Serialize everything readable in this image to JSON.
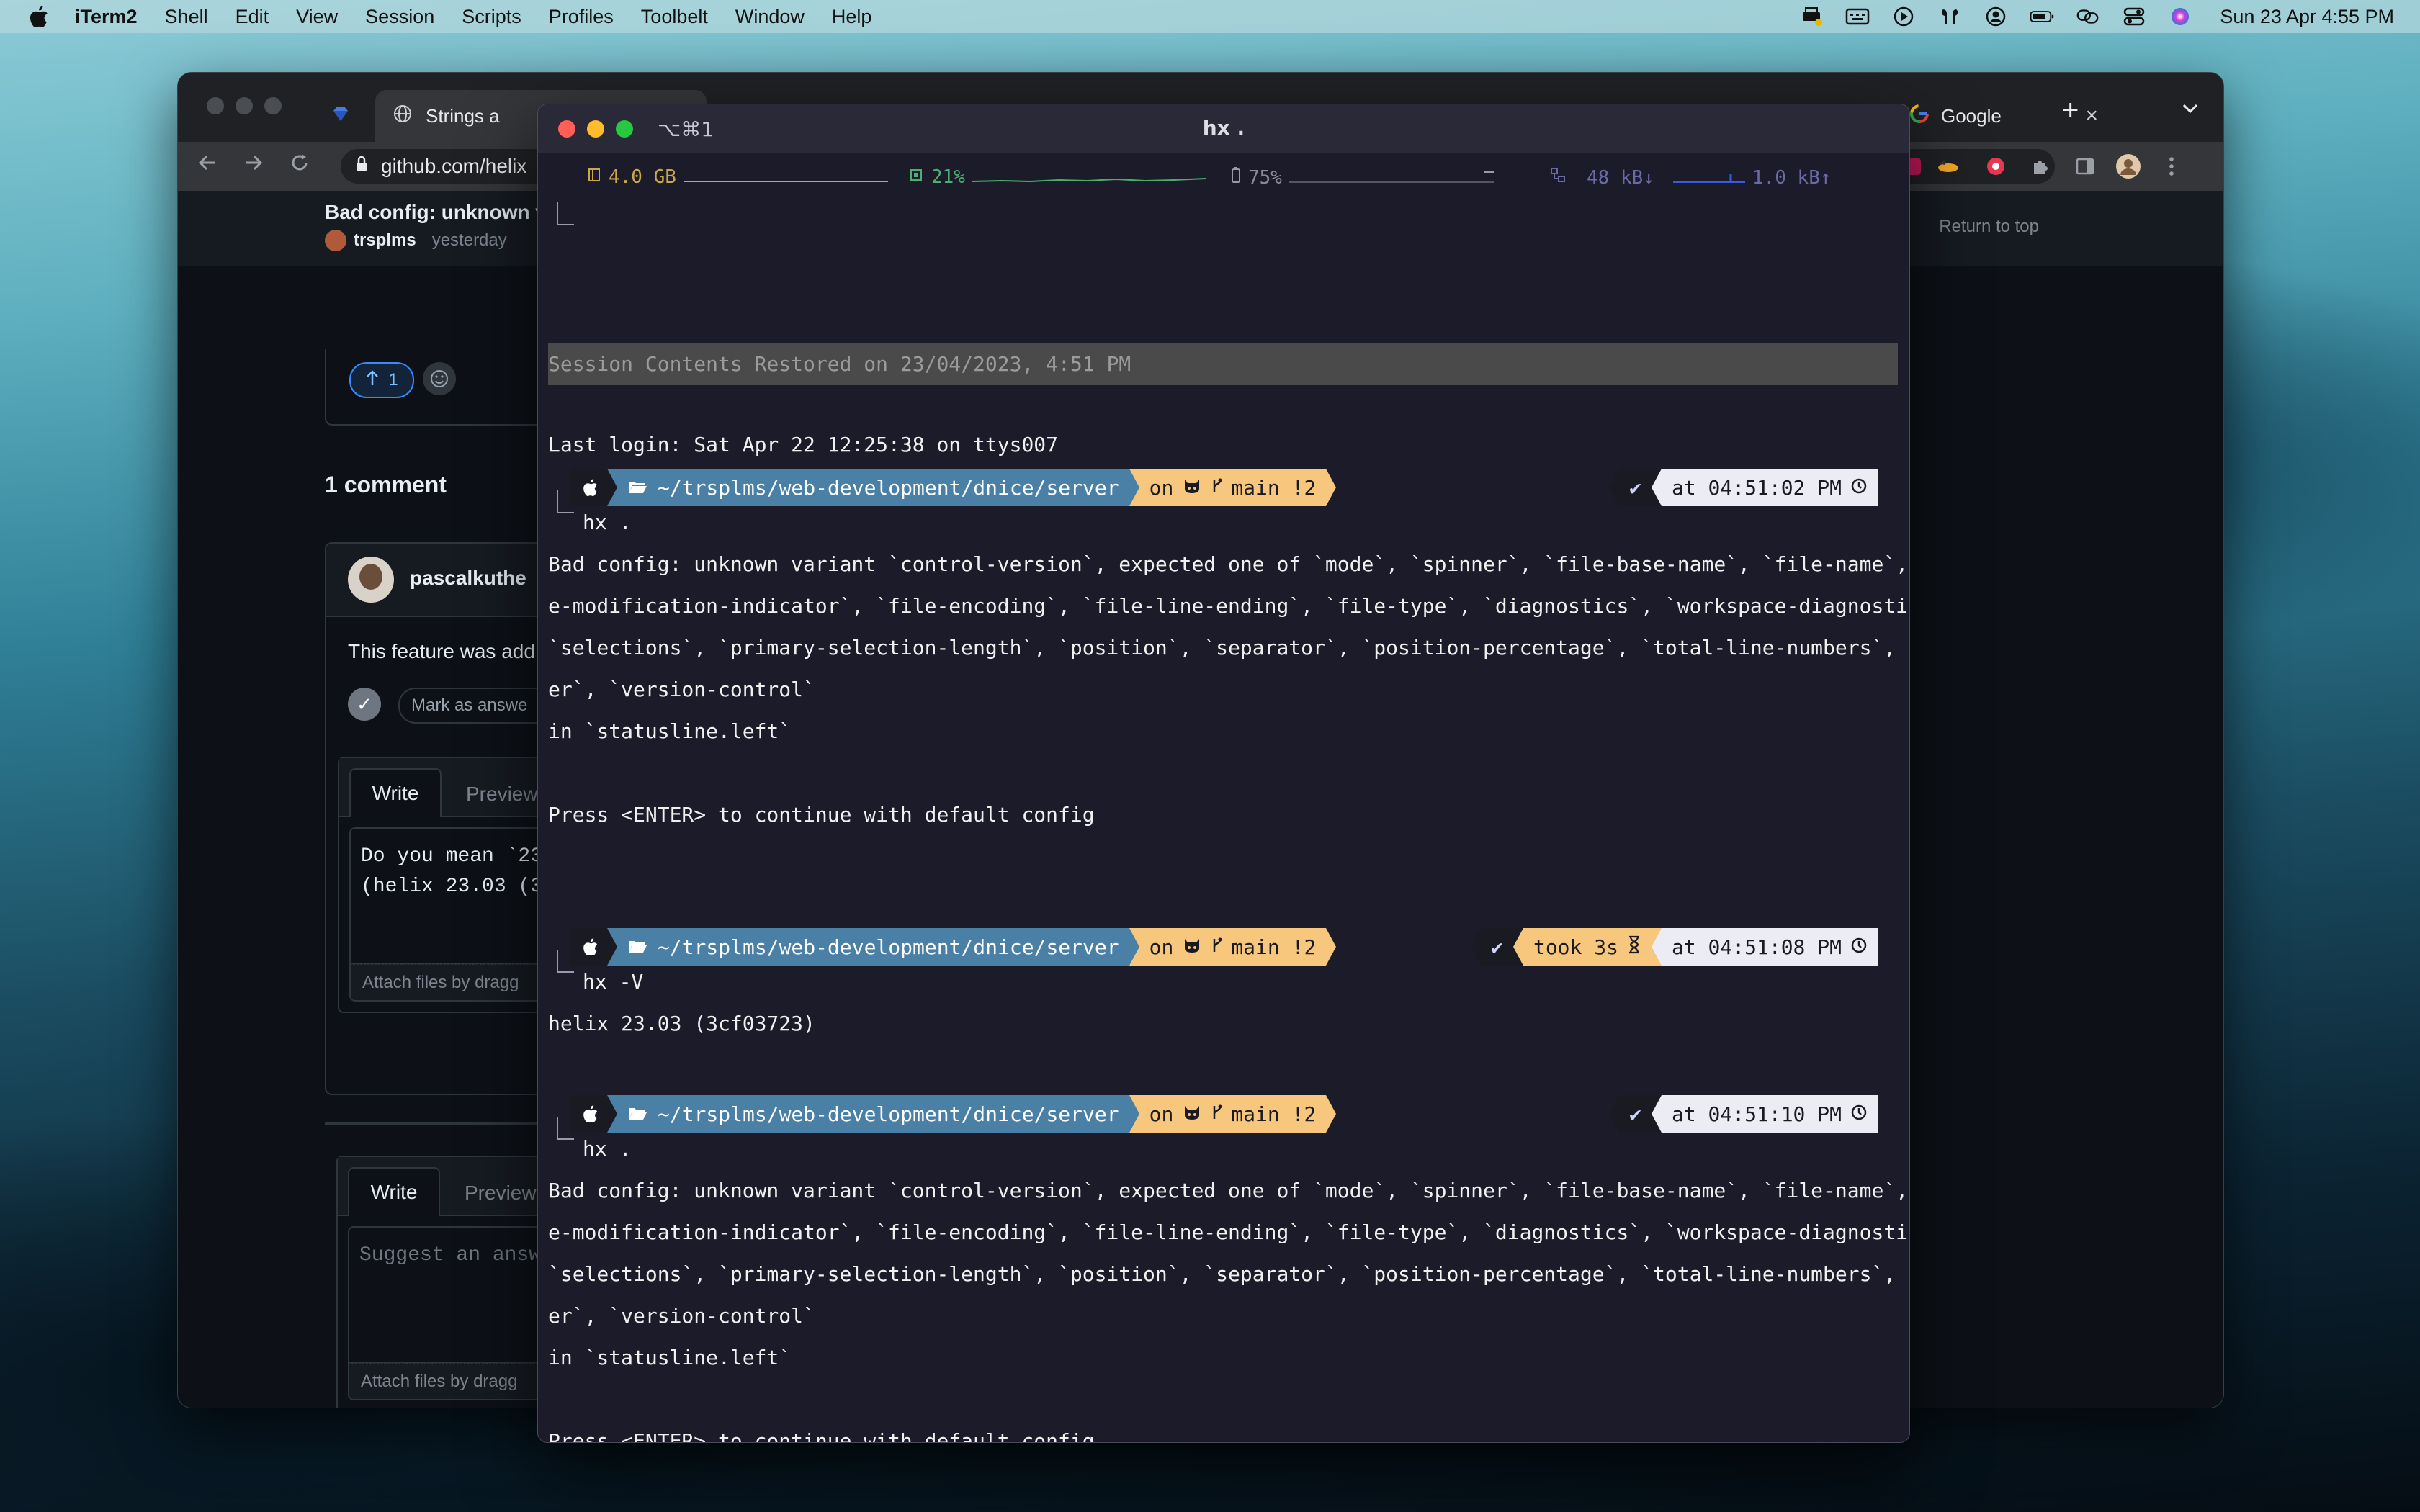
{
  "menubar": {
    "app": "iTerm2",
    "items": [
      "Shell",
      "Edit",
      "View",
      "Session",
      "Scripts",
      "Profiles",
      "Toolbelt",
      "Window",
      "Help"
    ],
    "clock": "Sun 23 Apr  4:55 PM"
  },
  "browser": {
    "tab_strings": "Strings a",
    "tab_google": "Google",
    "url": "github.com/helix",
    "issue_title": "Bad config: unknown v",
    "author": "trsplms",
    "posted": "yesterday",
    "return_to_top": "Return to top",
    "vote_count": "1",
    "comments_heading": "1 comment",
    "commenter": "pascalkuthe",
    "comment_text": "This feature was add",
    "mark_answer": "Mark as answe",
    "editor1": {
      "write": "Write",
      "preview": "Preview",
      "content_line1": "Do you mean `23",
      "content_line2": "(helix 23.03 (3",
      "attach": "Attach files by dragg"
    },
    "editor2": {
      "write": "Write",
      "preview": "Preview",
      "placeholder": "Suggest an answ",
      "attach": "Attach files by dragg"
    }
  },
  "terminal": {
    "shortcut": "⌥⌘1",
    "title": "hx .",
    "status": {
      "memory": "4.0 GB",
      "cpu": "21%",
      "battery": "75%",
      "net_down": "48 kB↓",
      "net_up": "1.0 kB↑"
    },
    "restored": "Session Contents Restored on 23/04/2023, 4:51 PM",
    "last_login": "Last login: Sat Apr 22 12:25:38 on ttys007",
    "prompt_path": "~/trsplms/web-development/dnice/server",
    "prompt_git_on": "on",
    "prompt_branch": "main !2",
    "prompts": [
      {
        "time": "at 04:51:02 PM",
        "command": "hx ."
      },
      {
        "time": "at 04:51:08 PM",
        "took": "took 3s",
        "command": "hx -V"
      },
      {
        "time": "at 04:51:10 PM",
        "command": "hx ."
      }
    ],
    "error_block_1": [
      "Bad config: unknown variant `control-version`, expected one of `mode`, `spinner`, `file-base-name`, `file-name`, `fil",
      "e-modification-indicator`, `file-encoding`, `file-line-ending`, `file-type`, `diagnostics`, `workspace-diagnostics`,",
      "`selections`, `primary-selection-length`, `position`, `separator`, `position-percentage`, `total-line-numbers`, `spac",
      "er`, `version-control`",
      "in `statusline.left`",
      "",
      "Press <ENTER> to continue with default config"
    ],
    "version_output": "helix 23.03 (3cf03723)",
    "error_block_2": [
      "Bad config: unknown variant `control-version`, expected one of `mode`, `spinner`, `file-base-name`, `file-name`, `fil",
      "e-modification-indicator`, `file-encoding`, `file-line-ending`, `file-type`, `diagnostics`, `workspace-diagnostics`,",
      "`selections`, `primary-selection-length`, `position`, `separator`, `position-percentage`, `total-line-numbers`, `spac",
      "er`, `version-control`",
      "in `statusline.left`",
      "",
      "Press <ENTER> to continue with default config"
    ]
  }
}
